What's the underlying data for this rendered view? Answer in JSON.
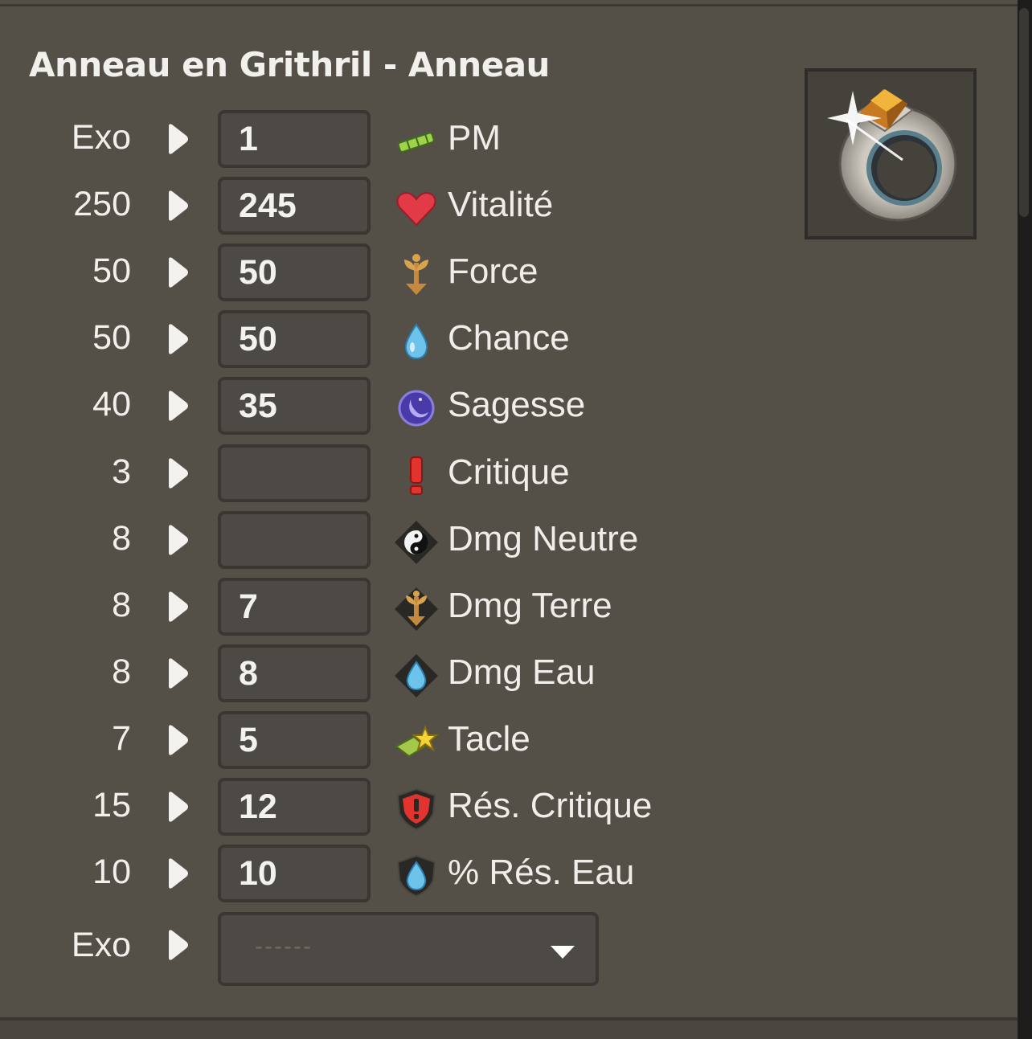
{
  "panel": {
    "title": "Anneau en Grithril - Anneau",
    "item_image_name": "ring-icon"
  },
  "rows": [
    {
      "max": "Exo",
      "value": "1",
      "label": "PM",
      "icon": "pm-icon"
    },
    {
      "max": "250",
      "value": "245",
      "label": "Vitalité",
      "icon": "heart-icon"
    },
    {
      "max": "50",
      "value": "50",
      "label": "Force",
      "icon": "force-icon"
    },
    {
      "max": "50",
      "value": "50",
      "label": "Chance",
      "icon": "water-drop-icon"
    },
    {
      "max": "40",
      "value": "35",
      "label": "Sagesse",
      "icon": "moon-icon"
    },
    {
      "max": "3",
      "value": "",
      "label": "Critique",
      "icon": "critical-icon"
    },
    {
      "max": "8",
      "value": "",
      "label": "Dmg Neutre",
      "icon": "neutral-damage-icon"
    },
    {
      "max": "8",
      "value": "7",
      "label": "Dmg Terre",
      "icon": "earth-damage-icon"
    },
    {
      "max": "8",
      "value": "8",
      "label": "Dmg Eau",
      "icon": "water-damage-icon"
    },
    {
      "max": "7",
      "value": "5",
      "label": "Tacle",
      "icon": "tackle-icon"
    },
    {
      "max": "15",
      "value": "12",
      "label": "Rés. Critique",
      "icon": "critical-resistance-icon"
    },
    {
      "max": "10",
      "value": "10",
      "label": "% Rés. Eau",
      "icon": "water-resistance-icon"
    }
  ],
  "exo": {
    "label": "Exo",
    "selected": "------"
  },
  "colors": {
    "background": "#545048",
    "field": "#4d4944",
    "border": "#3a3733",
    "text": "#f2f0ec"
  }
}
